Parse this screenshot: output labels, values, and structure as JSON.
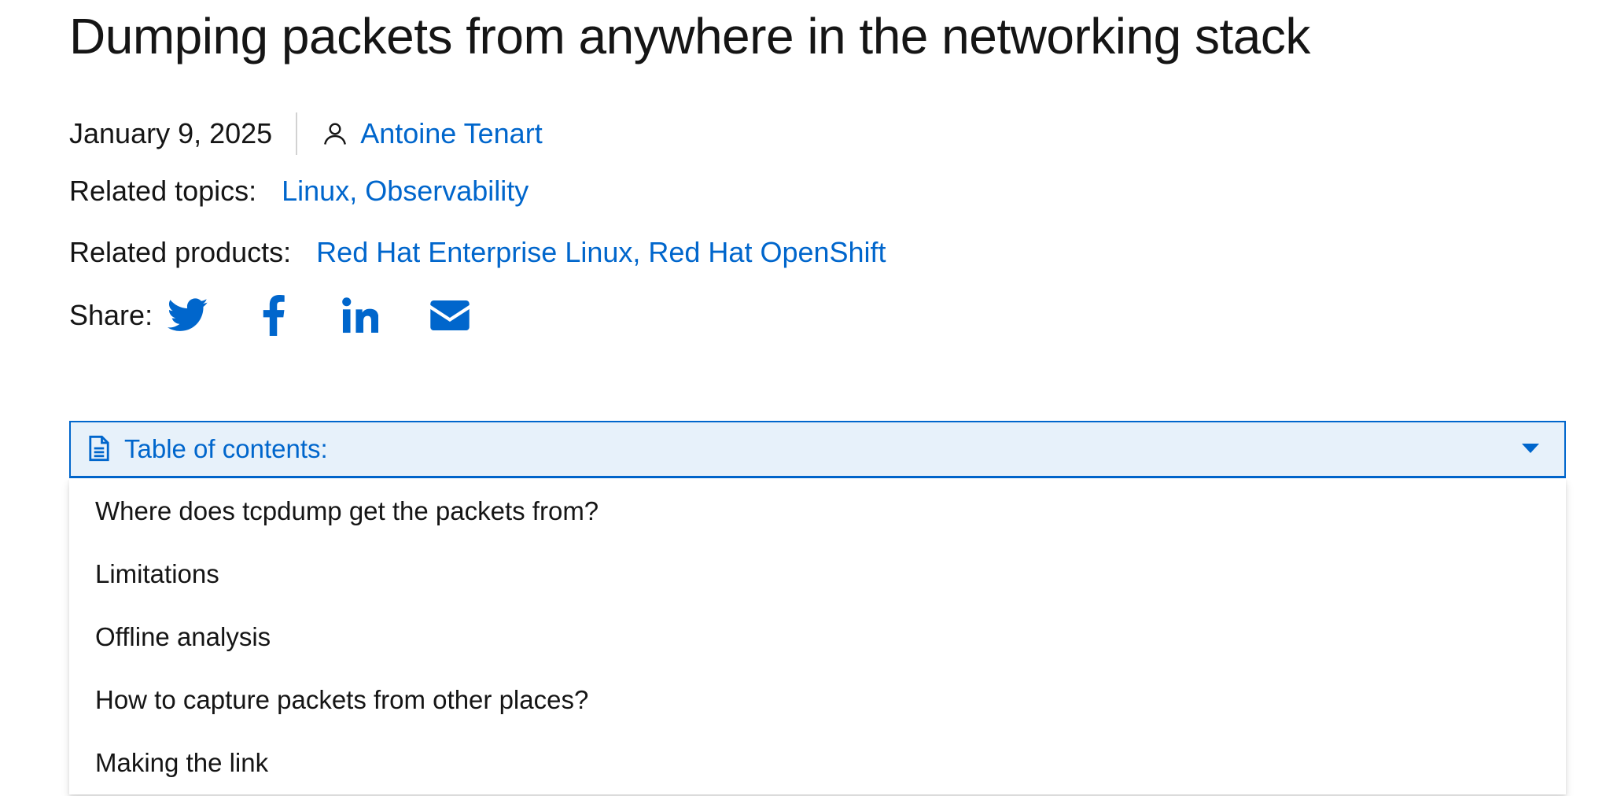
{
  "article": {
    "title": "Dumping packets from anywhere in the networking stack",
    "date": "January 9, 2025",
    "author": "Antoine Tenart"
  },
  "related_topics": {
    "label": "Related topics:",
    "value": "Linux, Observability"
  },
  "related_products": {
    "label": "Related products:",
    "value": "Red Hat Enterprise Linux, Red Hat OpenShift"
  },
  "share": {
    "label": "Share:",
    "icons": [
      "twitter-icon",
      "facebook-icon",
      "linkedin-icon",
      "mail-icon"
    ]
  },
  "toc": {
    "title": "Table of contents:",
    "items": [
      "Where does tcpdump get the packets from?",
      "Limitations",
      "Offline analysis",
      "How to capture packets from other places?",
      "Making the link"
    ]
  },
  "colors": {
    "accent": "#0066cc",
    "toc_header_bg": "#e7f1fa",
    "text": "#151515"
  }
}
